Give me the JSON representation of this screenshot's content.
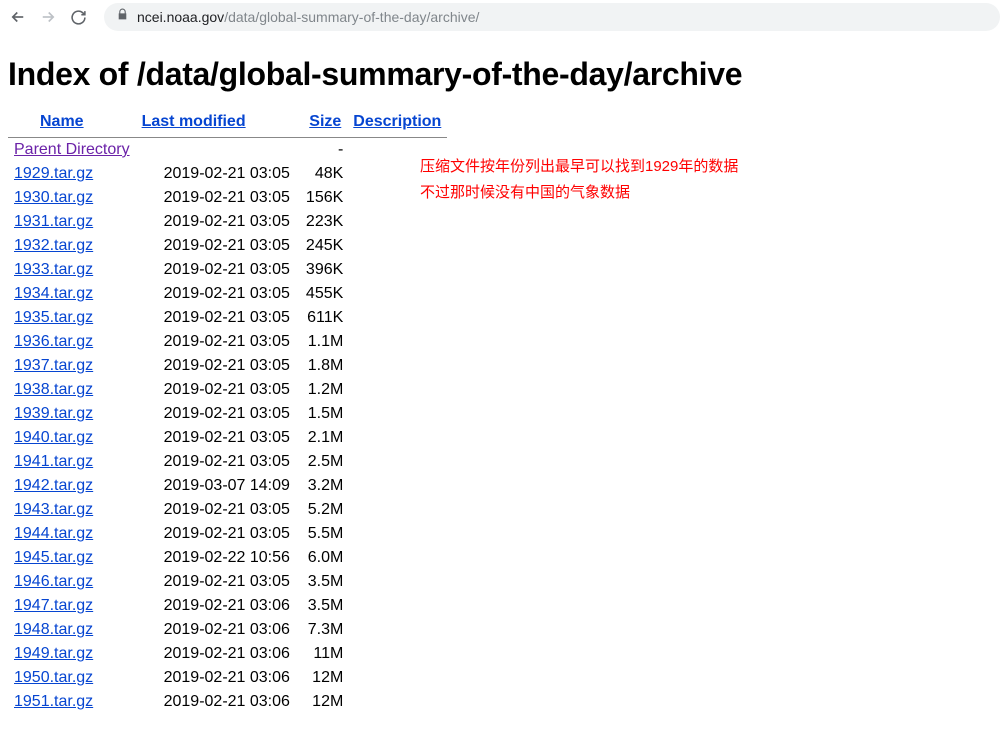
{
  "browser": {
    "url_host": "ncei.noaa.gov",
    "url_path": "/data/global-summary-of-the-day/archive/"
  },
  "heading": "Index of /data/global-summary-of-the-day/archive",
  "columns": {
    "name": "Name",
    "modified": "Last modified",
    "size": "Size",
    "description": "Description"
  },
  "parent": {
    "label": "Parent Directory",
    "size": "-"
  },
  "files": [
    {
      "name": "1929.tar.gz",
      "modified": "2019-02-21 03:05",
      "size": "48K"
    },
    {
      "name": "1930.tar.gz",
      "modified": "2019-02-21 03:05",
      "size": "156K"
    },
    {
      "name": "1931.tar.gz",
      "modified": "2019-02-21 03:05",
      "size": "223K"
    },
    {
      "name": "1932.tar.gz",
      "modified": "2019-02-21 03:05",
      "size": "245K"
    },
    {
      "name": "1933.tar.gz",
      "modified": "2019-02-21 03:05",
      "size": "396K"
    },
    {
      "name": "1934.tar.gz",
      "modified": "2019-02-21 03:05",
      "size": "455K"
    },
    {
      "name": "1935.tar.gz",
      "modified": "2019-02-21 03:05",
      "size": "611K"
    },
    {
      "name": "1936.tar.gz",
      "modified": "2019-02-21 03:05",
      "size": "1.1M"
    },
    {
      "name": "1937.tar.gz",
      "modified": "2019-02-21 03:05",
      "size": "1.8M"
    },
    {
      "name": "1938.tar.gz",
      "modified": "2019-02-21 03:05",
      "size": "1.2M"
    },
    {
      "name": "1939.tar.gz",
      "modified": "2019-02-21 03:05",
      "size": "1.5M"
    },
    {
      "name": "1940.tar.gz",
      "modified": "2019-02-21 03:05",
      "size": "2.1M"
    },
    {
      "name": "1941.tar.gz",
      "modified": "2019-02-21 03:05",
      "size": "2.5M"
    },
    {
      "name": "1942.tar.gz",
      "modified": "2019-03-07 14:09",
      "size": "3.2M"
    },
    {
      "name": "1943.tar.gz",
      "modified": "2019-02-21 03:05",
      "size": "5.2M"
    },
    {
      "name": "1944.tar.gz",
      "modified": "2019-02-21 03:05",
      "size": "5.5M"
    },
    {
      "name": "1945.tar.gz",
      "modified": "2019-02-22 10:56",
      "size": "6.0M"
    },
    {
      "name": "1946.tar.gz",
      "modified": "2019-02-21 03:05",
      "size": "3.5M"
    },
    {
      "name": "1947.tar.gz",
      "modified": "2019-02-21 03:06",
      "size": "3.5M"
    },
    {
      "name": "1948.tar.gz",
      "modified": "2019-02-21 03:06",
      "size": "7.3M"
    },
    {
      "name": "1949.tar.gz",
      "modified": "2019-02-21 03:06",
      "size": "11M"
    },
    {
      "name": "1950.tar.gz",
      "modified": "2019-02-21 03:06",
      "size": "12M"
    },
    {
      "name": "1951.tar.gz",
      "modified": "2019-02-21 03:06",
      "size": "12M"
    }
  ],
  "annotation": {
    "line1": "压缩文件按年份列出最早可以找到1929年的数据",
    "line2": "不过那时候没有中国的气象数据"
  }
}
